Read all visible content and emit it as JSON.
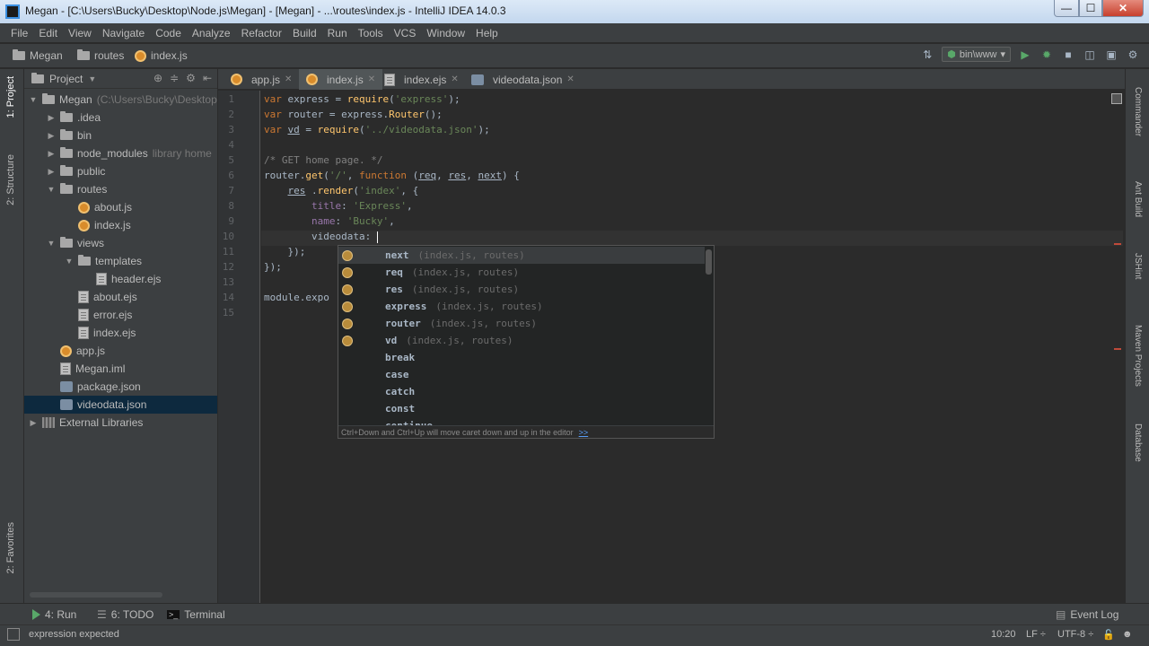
{
  "window": {
    "title": "Megan - [C:\\Users\\Bucky\\Desktop\\Node.js\\Megan] - [Megan] - ...\\routes\\index.js - IntelliJ IDEA 14.0.3",
    "min": "—",
    "max": "☐",
    "close": "✕"
  },
  "menu": [
    "File",
    "Edit",
    "View",
    "Navigate",
    "Code",
    "Analyze",
    "Refactor",
    "Build",
    "Run",
    "Tools",
    "VCS",
    "Window",
    "Help"
  ],
  "breadcrumb": {
    "project": "Megan",
    "folder": "routes",
    "file": "index.js"
  },
  "run_config": "bin\\www",
  "project_panel": {
    "title": "Project",
    "tree": [
      {
        "label": "Megan",
        "hint": "(C:\\Users\\Bucky\\Desktop",
        "depth": 0,
        "twisty": "▼",
        "icon": "folder"
      },
      {
        "label": ".idea",
        "hint": "",
        "depth": 1,
        "twisty": "▶",
        "icon": "folder"
      },
      {
        "label": "bin",
        "hint": "",
        "depth": 1,
        "twisty": "▶",
        "icon": "folder"
      },
      {
        "label": "node_modules",
        "hint": "library home",
        "depth": 1,
        "twisty": "▶",
        "icon": "folder"
      },
      {
        "label": "public",
        "hint": "",
        "depth": 1,
        "twisty": "▶",
        "icon": "folder"
      },
      {
        "label": "routes",
        "hint": "",
        "depth": 1,
        "twisty": "▼",
        "icon": "folder"
      },
      {
        "label": "about.js",
        "hint": "",
        "depth": 2,
        "twisty": "",
        "icon": "js"
      },
      {
        "label": "index.js",
        "hint": "",
        "depth": 2,
        "twisty": "",
        "icon": "js"
      },
      {
        "label": "views",
        "hint": "",
        "depth": 1,
        "twisty": "▼",
        "icon": "folder"
      },
      {
        "label": "templates",
        "hint": "",
        "depth": 2,
        "twisty": "▼",
        "icon": "folder"
      },
      {
        "label": "header.ejs",
        "hint": "",
        "depth": 3,
        "twisty": "",
        "icon": "file"
      },
      {
        "label": "about.ejs",
        "hint": "",
        "depth": 2,
        "twisty": "",
        "icon": "file"
      },
      {
        "label": "error.ejs",
        "hint": "",
        "depth": 2,
        "twisty": "",
        "icon": "file"
      },
      {
        "label": "index.ejs",
        "hint": "",
        "depth": 2,
        "twisty": "",
        "icon": "file"
      },
      {
        "label": "app.js",
        "hint": "",
        "depth": 1,
        "twisty": "",
        "icon": "js"
      },
      {
        "label": "Megan.iml",
        "hint": "",
        "depth": 1,
        "twisty": "",
        "icon": "file"
      },
      {
        "label": "package.json",
        "hint": "",
        "depth": 1,
        "twisty": "",
        "icon": "json"
      },
      {
        "label": "videodata.json",
        "hint": "",
        "depth": 1,
        "twisty": "",
        "icon": "json",
        "selected": true
      },
      {
        "label": "External Libraries",
        "hint": "",
        "depth": 0,
        "twisty": "▶",
        "icon": "ext"
      }
    ]
  },
  "tabs": [
    {
      "label": "app.js",
      "icon": "js",
      "active": false
    },
    {
      "label": "index.js",
      "icon": "js",
      "active": true
    },
    {
      "label": "index.ejs",
      "icon": "file",
      "active": false
    },
    {
      "label": "videodata.json",
      "icon": "json",
      "active": false
    }
  ],
  "code": {
    "line_numbers": [
      "1",
      "2",
      "3",
      "4",
      "5",
      "6",
      "7",
      "8",
      "9",
      "10",
      "11",
      "12",
      "13",
      "14",
      "15"
    ],
    "lines": [
      [
        [
          "kw",
          "var "
        ],
        [
          "",
          "express = "
        ],
        [
          "fn",
          "require"
        ],
        [
          "",
          "("
        ],
        [
          "str",
          "'express'"
        ],
        [
          "",
          ");"
        ]
      ],
      [
        [
          "kw",
          "var "
        ],
        [
          "",
          "router = express."
        ],
        [
          "fn",
          "Router"
        ],
        [
          "",
          "();"
        ]
      ],
      [
        [
          "kw",
          "var "
        ],
        [
          "ul",
          "vd"
        ],
        [
          "",
          " = "
        ],
        [
          "fn",
          "require"
        ],
        [
          "",
          "("
        ],
        [
          "str",
          "'../videodata.json'"
        ],
        [
          "",
          ");"
        ]
      ],
      [
        [
          "",
          ""
        ]
      ],
      [
        [
          "cm",
          "/* GET home page. */"
        ]
      ],
      [
        [
          "",
          "router."
        ],
        [
          "fn",
          "get"
        ],
        [
          "",
          "("
        ],
        [
          "str",
          "'/'"
        ],
        [
          "",
          ", "
        ],
        [
          "kw",
          "function "
        ],
        [
          "",
          "("
        ],
        [
          "ul",
          "req"
        ],
        [
          "",
          ", "
        ],
        [
          "ul",
          "res"
        ],
        [
          "",
          ", "
        ],
        [
          "ul",
          "next"
        ],
        [
          "",
          ") {"
        ]
      ],
      [
        [
          "",
          "    "
        ],
        [
          "ul",
          "res"
        ],
        [
          "",
          " ."
        ],
        [
          "fn",
          "render"
        ],
        [
          "",
          "("
        ],
        [
          "str",
          "'index'"
        ],
        [
          "",
          ", {"
        ]
      ],
      [
        [
          "",
          "        "
        ],
        [
          "prop",
          "title"
        ],
        [
          "",
          ": "
        ],
        [
          "str",
          "'Express'"
        ],
        [
          "",
          ","
        ]
      ],
      [
        [
          "",
          "        "
        ],
        [
          "prop",
          "name"
        ],
        [
          "",
          ": "
        ],
        [
          "str",
          "'Bucky'"
        ],
        [
          "",
          ","
        ]
      ],
      [
        [
          "",
          "        "
        ],
        [
          "",
          "videodata: "
        ]
      ],
      [
        [
          "",
          "    });"
        ]
      ],
      [
        [
          "",
          "});"
        ]
      ],
      [
        [
          "",
          ""
        ]
      ],
      [
        [
          "",
          "module.expo"
        ]
      ],
      [
        [
          "",
          ""
        ]
      ]
    ]
  },
  "completion": {
    "items": [
      {
        "name": "next",
        "hint": "(index.js, routes)",
        "icon": true
      },
      {
        "name": "req",
        "hint": "(index.js, routes)",
        "icon": true
      },
      {
        "name": "res",
        "hint": "(index.js, routes)",
        "icon": true
      },
      {
        "name": "express",
        "hint": "(index.js, routes)",
        "icon": true
      },
      {
        "name": "router",
        "hint": "(index.js, routes)",
        "icon": true
      },
      {
        "name": "vd",
        "hint": "(index.js, routes)",
        "icon": true
      },
      {
        "name": "break",
        "hint": "",
        "icon": false
      },
      {
        "name": "case",
        "hint": "",
        "icon": false
      },
      {
        "name": "catch",
        "hint": "",
        "icon": false
      },
      {
        "name": "const",
        "hint": "",
        "icon": false
      },
      {
        "name": "continue",
        "hint": "",
        "icon": false
      }
    ],
    "footer": "Ctrl+Down and Ctrl+Up will move caret down and up in the editor",
    "footer_link": ">>"
  },
  "left_tabs": [
    "1: Project",
    "2: Structure",
    "2: Favorites"
  ],
  "right_tabs": [
    "Commander",
    "Ant Build",
    "JSHint",
    "Maven Projects",
    "Database"
  ],
  "bottom_tools": {
    "run": "4: Run",
    "todo": "6: TODO",
    "terminal": "Terminal",
    "event_log": "Event Log"
  },
  "status": {
    "message": "expression expected",
    "position": "10:20",
    "line_sep": "LF ÷",
    "encoding": "UTF-8 ÷"
  },
  "colors": {
    "accent": "#3592c4",
    "selection": "#0d293e",
    "editor_bg": "#2b2b2b"
  }
}
